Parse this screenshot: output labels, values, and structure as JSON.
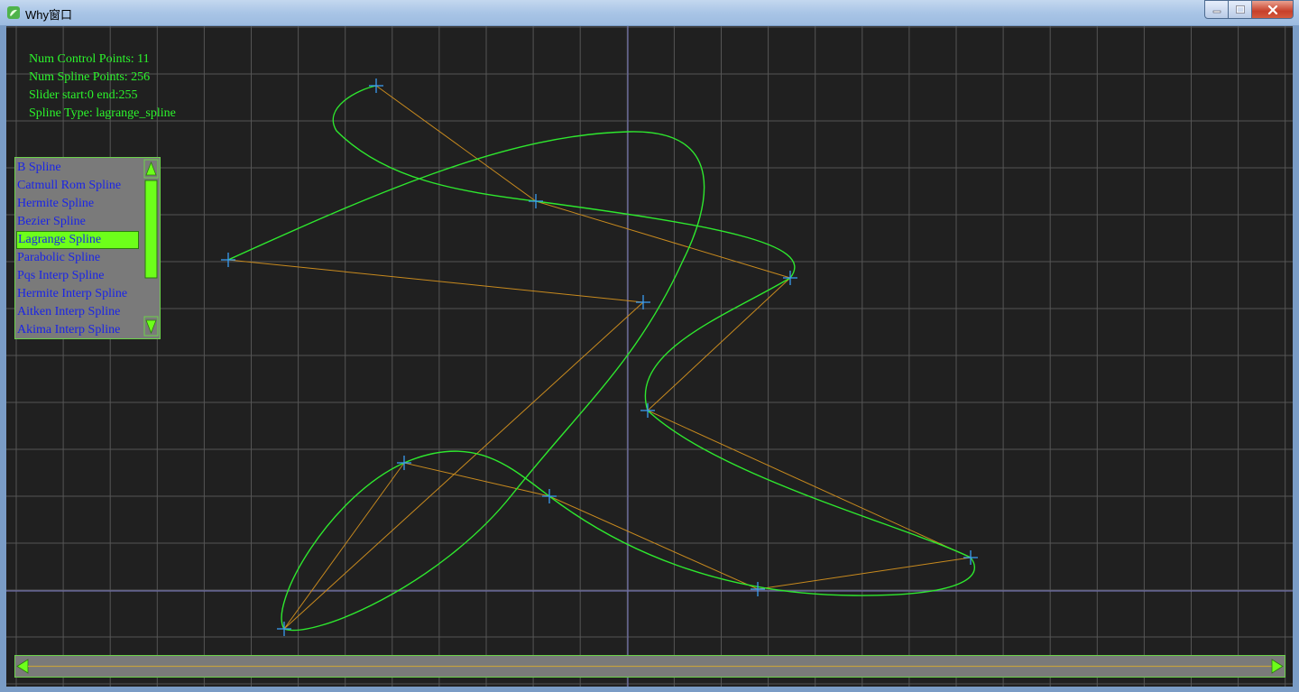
{
  "window": {
    "title": "Why窗口",
    "bg_color": "#202020",
    "accent_color": "#6dff1a",
    "curve_color": "#2ee82e",
    "polyline_color": "#c88a1e",
    "marker_color": "#3a9bf0"
  },
  "info": {
    "control_points": "Num Control Points: 11",
    "spline_points": "Num Spline Points: 256",
    "slider": "Slider start:0 end:255",
    "spline_type": "Spline Type: lagrange_spline"
  },
  "spline_list": {
    "selected_index": 4,
    "items": [
      "B Spline",
      "Catmull Rom Spline",
      "Hermite Spline",
      "Bezier Spline",
      "Lagrange Spline",
      "Parabolic Spline",
      "Pqs Interp Spline",
      "Hermite Interp Spline",
      "Aitken Interp Spline",
      "Akima Interp Spline"
    ]
  },
  "slider": {
    "start": 0,
    "end": 255,
    "max": 255
  }
}
